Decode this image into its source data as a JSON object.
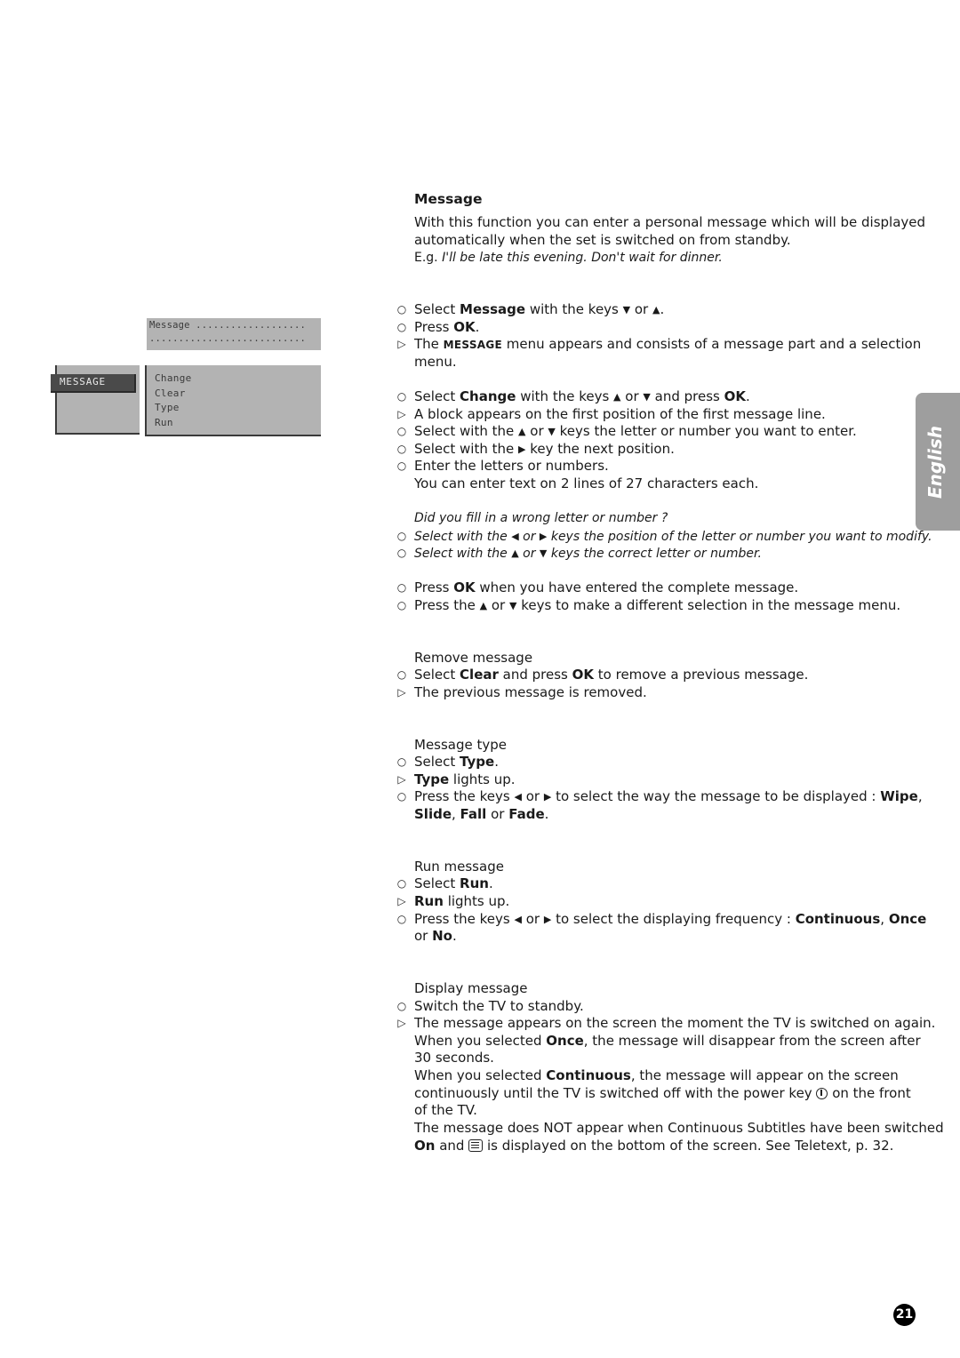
{
  "osd": {
    "message_label": "Message ...................",
    "message_line2": "...........................",
    "tab_label": "MESSAGE",
    "options": [
      "Change",
      "Clear",
      "Type",
      "Run"
    ]
  },
  "intro": {
    "title": "Message",
    "line1": "With this function you can enter a personal message which will be displayed",
    "line2": "automatically when the set is switched on from standby.",
    "eg_prefix": "E.g. ",
    "eg_text": "I'll be late this evening. Don't wait for dinner."
  },
  "keys": {
    "up": "▲",
    "down": "▼",
    "left": "◀",
    "right": "▶"
  },
  "bullets": {
    "step": "○",
    "result": "▷"
  },
  "s1": {
    "a1": "Select ",
    "a2": "Message",
    "a3": " with the keys ",
    "a4": " or ",
    "a5": ".",
    "b1": "Press ",
    "b2": "OK",
    "b3": ".",
    "c1": "The ",
    "c2": "MESSAGE",
    "c3": " menu appears and consists of a message part and a selection",
    "c4": "menu."
  },
  "s2": {
    "a1": "Select ",
    "a2": "Change",
    "a3": " with the keys ",
    "a4": " or ",
    "a5": " and press ",
    "a6": "OK",
    "a7": ".",
    "b": "A block appears on the first position of the first message line.",
    "c1": "Select with the ",
    "c2": " or ",
    "c3": " keys the letter or number you want to enter.",
    "d1": "Select with the ",
    "d2": " key the next position.",
    "e": "Enter the letters or numbers.",
    "f": "You can enter text on 2 lines of 27 characters each."
  },
  "s3": {
    "q": "Did you fill in a wrong letter or number ?",
    "a1": "Select with the ",
    "a2": " or ",
    "a3": " keys the position of the letter or number you want to modify.",
    "b1": "Select with the ",
    "b2": " or ",
    "b3": " keys the correct letter or number."
  },
  "s4": {
    "a1": "Press ",
    "a2": "OK",
    "a3": " when you have entered the complete message.",
    "b1": "Press the ",
    "b2": " or ",
    "b3": " keys to make a different selection in the message menu."
  },
  "remove": {
    "title": "Remove message",
    "a1": "Select ",
    "a2": "Clear",
    "a3": " and press ",
    "a4": "OK",
    "a5": " to remove a previous message.",
    "b": "The previous message is removed."
  },
  "type": {
    "title": "Message type",
    "a1": "Select ",
    "a2": "Type",
    "a3": ".",
    "b1": "Type",
    "b2": " lights up.",
    "c1": "Press the keys ",
    "c2": " or ",
    "c3": " to select the way the message to be displayed : ",
    "c4": "Wipe",
    "c5": ",",
    "d1": "Slide",
    "d2": ", ",
    "d3": "Fall",
    "d4": " or ",
    "d5": "Fade",
    "d6": "."
  },
  "run": {
    "title": "Run message",
    "a1": "Select ",
    "a2": "Run",
    "a3": ".",
    "b1": "Run",
    "b2": " lights up.",
    "c1": "Press the keys ",
    "c2": " or ",
    "c3": " to select the displaying frequency : ",
    "c4": "Continuous",
    "c5": ", ",
    "c6": "Once",
    "d1": "or ",
    "d2": "No",
    "d3": "."
  },
  "display": {
    "title": "Display message",
    "a": "Switch the TV to standby.",
    "b": "The message appears on the screen the moment the TV is switched on again.",
    "c1": "When you selected ",
    "c2": "Once",
    "c3": ", the message will disappear from the screen after",
    "d": "30 seconds.",
    "e1": "When you selected ",
    "e2": "Continuous",
    "e3": ", the message will appear on the screen",
    "f1": "continuously until the TV is switched off with the power key ",
    "f2": " on the front",
    "g": "of the TV.",
    "h": "The message does NOT appear when Continuous Subtitles have been switched",
    "i1": "On",
    "i2": " and ",
    "i3": " is displayed on the bottom of the screen. See Teletext, p. 32."
  },
  "side_tab": "English",
  "page_number": "21"
}
